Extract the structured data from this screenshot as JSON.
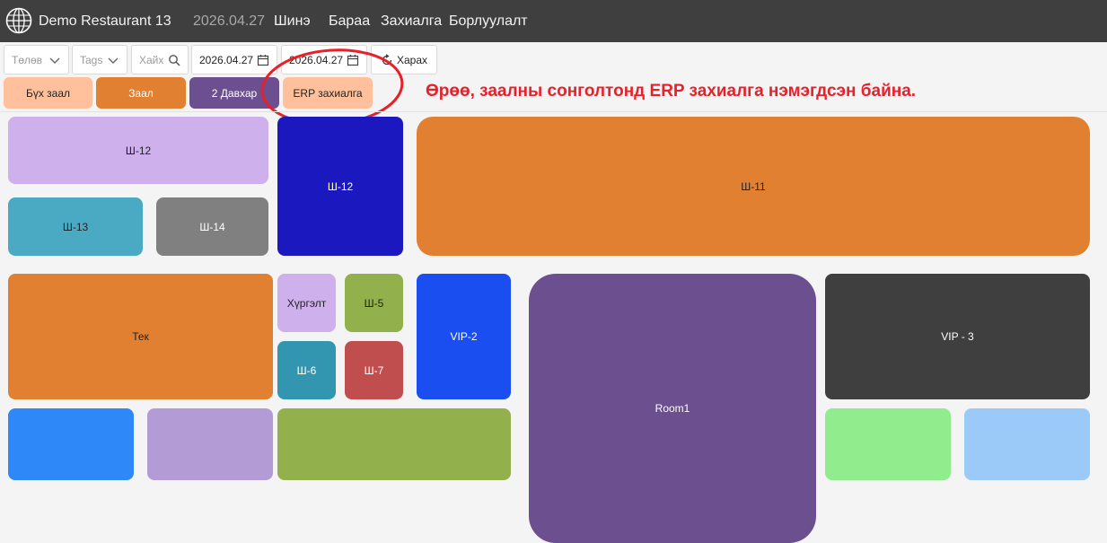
{
  "header": {
    "app_title": "Demo Restaurant 13",
    "date": "2026.04.27",
    "nav": [
      "Шинэ",
      "Бараа",
      "Захиалга",
      "Борлуулалт"
    ]
  },
  "toolbar": {
    "status_placeholder": "Төлөв",
    "tags_placeholder": "Tags",
    "search_placeholder": "Хайх",
    "date_from": "2026.04.27",
    "date_to": "2026.04.27",
    "view_label": "Харах"
  },
  "halls": [
    {
      "label": "Бүх заал",
      "color": "#ffc09b"
    },
    {
      "label": "Заал",
      "color": "#e08030"
    },
    {
      "label": "2 Давхар",
      "color": "#6b4f8f"
    },
    {
      "label": "ERP захиалга",
      "color": "#ffc09b"
    }
  ],
  "annotation": {
    "note": "Өрөө, заалны сонголтонд ERP захиалга нэмэгдсэн байна.",
    "color": "#e8202a"
  },
  "tables": [
    {
      "label": "Ш-12",
      "color": "#cdb0ec"
    },
    {
      "label": "Ш-12",
      "color": "#1c18c0"
    },
    {
      "label": "Ш-11",
      "color": "#e08030"
    },
    {
      "label": "Ш-13",
      "color": "#4aaac4"
    },
    {
      "label": "Ш-14",
      "color": "#808080"
    },
    {
      "label": "Тек",
      "color": "#e08030"
    },
    {
      "label": "Хүргэлт",
      "color": "#cdb0ec"
    },
    {
      "label": "Ш-5",
      "color": "#92b04c"
    },
    {
      "label": "Ш-6",
      "color": "#3296b0"
    },
    {
      "label": "Ш-7",
      "color": "#c04e4e"
    },
    {
      "label": "VIP-2",
      "color": "#1a4ef0"
    },
    {
      "label": "Room1",
      "color": "#6b4f8f"
    },
    {
      "label": "VIP - 3",
      "color": "#3f3f3f"
    },
    {
      "label": "",
      "color": "#2e88f8"
    },
    {
      "label": "",
      "color": "#b39bd6"
    },
    {
      "label": "",
      "color": "#92b04c"
    },
    {
      "label": "",
      "color": "#90ec8c"
    },
    {
      "label": "",
      "color": "#9ccaf8"
    }
  ]
}
